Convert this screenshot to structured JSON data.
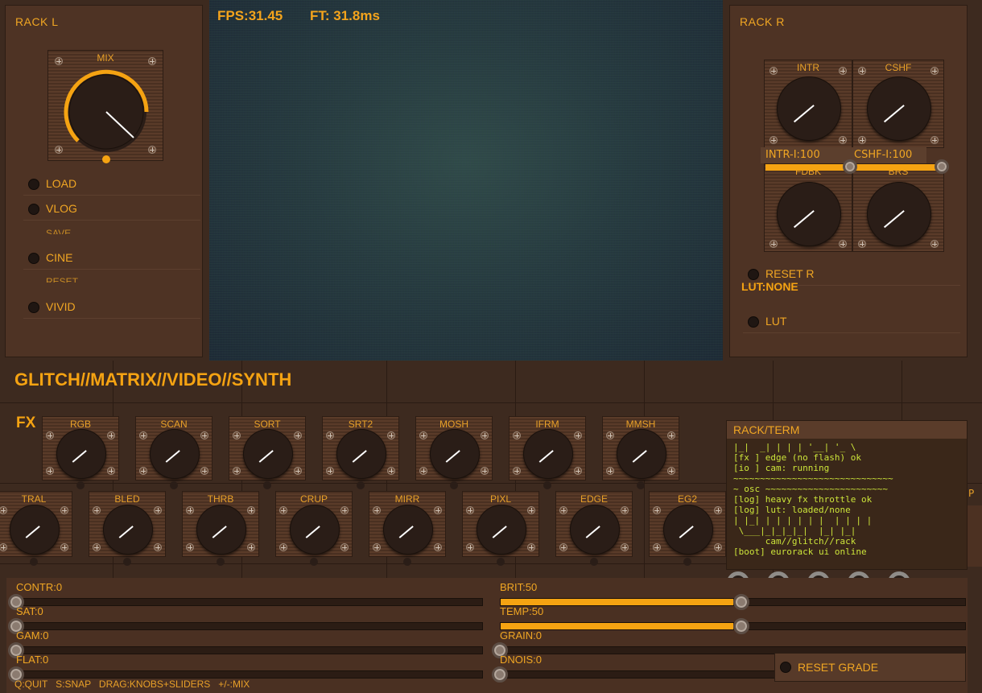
{
  "hud": {
    "fps": "FPS:31.45",
    "ft": "FT: 31.8ms"
  },
  "rack_l": {
    "title": "RACK L",
    "mix_label": "MIX",
    "buttons": [
      "LOAD",
      "VLOG",
      "CINE",
      "VIVID"
    ],
    "ghost_labels": [
      "SAVE",
      "RESET"
    ]
  },
  "rack_r": {
    "title": "RACK R",
    "knobs": [
      "INTR",
      "CSHF",
      "FDBK",
      "BRS"
    ],
    "tags": [
      "INTR-I:100",
      "CSHF-I:100"
    ],
    "reset_label": "RESET R",
    "lut_status": "LUT:NONE",
    "lut_button": "LUT"
  },
  "app_title": "GLITCH//MATRIX//VIDEO//SYNTH",
  "fx": {
    "title": "FX",
    "row1": [
      "RGB",
      "SCAN",
      "SORT",
      "SRT2",
      "MOSH",
      "IFRM",
      "MMSH"
    ],
    "row2": [
      "TRAL",
      "BLED",
      "THRB",
      "CRUP",
      "MIRR",
      "PIXL",
      "EDGE",
      "EG2"
    ],
    "row2_clipped_label": "P"
  },
  "terminal": {
    "title": "RACK/TERM",
    "lines": [
      "|_|  _| | | | '__| '_ \\",
      "[fx ] edge (no flash) ok",
      "[io ] cam: running",
      "~~~~~~~~~~~~~~~~~~~~~~~~~~~~~~",
      "~ osc ~~~~~~~~~~~~~~~~~~~~~~~",
      "[log] heavy fx throttle ok",
      "[log] lut: loaded/none",
      "| |_| | | | | | |  | | | |",
      " \\___|_|_|_|_|  |_| |_|",
      "      cam//glitch//rack",
      "[boot] eurorack ui online"
    ]
  },
  "grade": {
    "left": [
      {
        "label": "CONTR:0",
        "value": 0
      },
      {
        "label": "SAT:0",
        "value": 0
      },
      {
        "label": "GAM:0",
        "value": 0
      },
      {
        "label": "FLAT:0",
        "value": 0
      }
    ],
    "right": [
      {
        "label": "BRIT:50",
        "value": 0.5
      },
      {
        "label": "TEMP:50",
        "value": 0.5
      },
      {
        "label": "GRAIN:0",
        "value": 0
      },
      {
        "label": "DNOIS:0",
        "value": 0
      }
    ],
    "reset_label": "RESET GRADE"
  },
  "footer": "Q:QUIT   S:SNAP   DRAG:KNOBS+SLIDERS   +/-:MIX",
  "colors": {
    "accent": "#f5a312",
    "panel": "#4e3324",
    "terminal_text": "#cce43a"
  }
}
